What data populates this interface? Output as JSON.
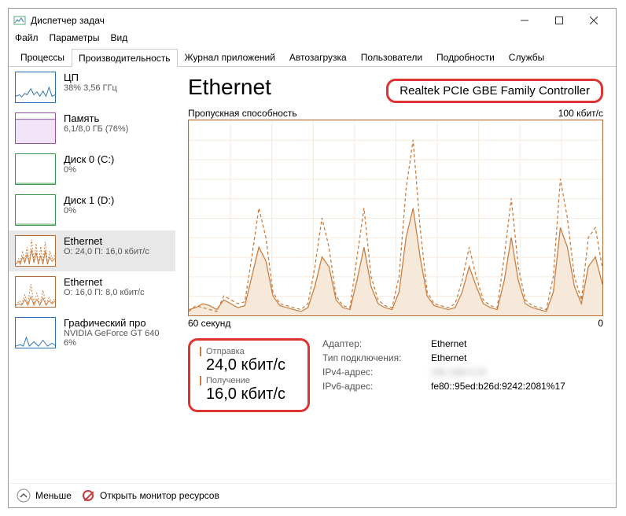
{
  "window": {
    "title": "Диспетчер задач"
  },
  "menu": {
    "file": "Файл",
    "options": "Параметры",
    "view": "Вид"
  },
  "tabs": [
    {
      "label": "Процессы"
    },
    {
      "label": "Производительность"
    },
    {
      "label": "Журнал приложений"
    },
    {
      "label": "Автозагрузка"
    },
    {
      "label": "Пользователи"
    },
    {
      "label": "Подробности"
    },
    {
      "label": "Службы"
    }
  ],
  "sidebar": {
    "items": [
      {
        "title": "ЦП",
        "sub": "38% 3,56 ГГц"
      },
      {
        "title": "Память",
        "sub": "6,1/8,0 ГБ (76%)"
      },
      {
        "title": "Диск 0 (C:)",
        "sub": "0%"
      },
      {
        "title": "Диск 1 (D:)",
        "sub": "0%"
      },
      {
        "title": "Ethernet",
        "sub": "О: 24,0 П: 16,0 кбит/с"
      },
      {
        "title": "Ethernet",
        "sub": "О: 16,0 П: 8,0 кбит/с"
      },
      {
        "title": "Графический про",
        "sub": "NVIDIA GeForce GT 640",
        "sub2": "6%"
      }
    ]
  },
  "main": {
    "title": "Ethernet",
    "adapter": "Realtek PCIe GBE Family Controller",
    "throughput_label": "Пропускная способность",
    "throughput_max": "100 кбит/с",
    "x_left": "60 секунд",
    "x_right": "0",
    "send_label": "Отправка",
    "send_value": "24,0 кбит/с",
    "recv_label": "Получение",
    "recv_value": "16,0 кбит/с",
    "kv": {
      "adapter_k": "Адаптер:",
      "adapter_v": "Ethernet",
      "conn_k": "Тип подключения:",
      "conn_v": "Ethernet",
      "ipv4_k": "IPv4-адрес:",
      "ipv4_v": "192.168.0.10",
      "ipv6_k": "IPv6-адрес:",
      "ipv6_v": "fe80::95ed:b26d:9242:2081%17"
    }
  },
  "footer": {
    "less": "Меньше",
    "resmon": "Открыть монитор ресурсов"
  },
  "chart_data": {
    "type": "line",
    "title": "Пропускная способность",
    "xlabel": "60 секунд",
    "ylabel": "",
    "ylim": [
      0,
      100
    ],
    "y_unit": "кбит/с",
    "x": [
      0,
      1,
      2,
      3,
      4,
      5,
      6,
      7,
      8,
      9,
      10,
      11,
      12,
      13,
      14,
      15,
      16,
      17,
      18,
      19,
      20,
      21,
      22,
      23,
      24,
      25,
      26,
      27,
      28,
      29,
      30,
      31,
      32,
      33,
      34,
      35,
      36,
      37,
      38,
      39,
      40,
      41,
      42,
      43,
      44,
      45,
      46,
      47,
      48,
      49,
      50,
      51,
      52,
      53,
      54,
      55,
      56,
      57,
      58,
      59
    ],
    "series": [
      {
        "name": "Отправка",
        "style": "dashed",
        "values": [
          2,
          5,
          4,
          3,
          2,
          10,
          8,
          6,
          7,
          30,
          55,
          40,
          12,
          6,
          5,
          4,
          3,
          6,
          25,
          50,
          35,
          10,
          5,
          4,
          30,
          55,
          20,
          8,
          5,
          4,
          20,
          65,
          90,
          45,
          12,
          6,
          5,
          4,
          6,
          18,
          35,
          20,
          8,
          5,
          4,
          30,
          60,
          25,
          8,
          5,
          4,
          3,
          20,
          70,
          50,
          20,
          8,
          40,
          45,
          24
        ]
      },
      {
        "name": "Получение",
        "style": "solid",
        "values": [
          3,
          4,
          6,
          5,
          3,
          8,
          6,
          4,
          5,
          20,
          35,
          28,
          10,
          5,
          4,
          3,
          2,
          4,
          15,
          30,
          25,
          8,
          4,
          3,
          18,
          35,
          15,
          6,
          4,
          3,
          12,
          40,
          55,
          30,
          10,
          5,
          4,
          3,
          4,
          12,
          25,
          15,
          6,
          4,
          3,
          18,
          40,
          18,
          6,
          4,
          3,
          2,
          12,
          45,
          35,
          15,
          6,
          25,
          30,
          16
        ]
      }
    ]
  }
}
